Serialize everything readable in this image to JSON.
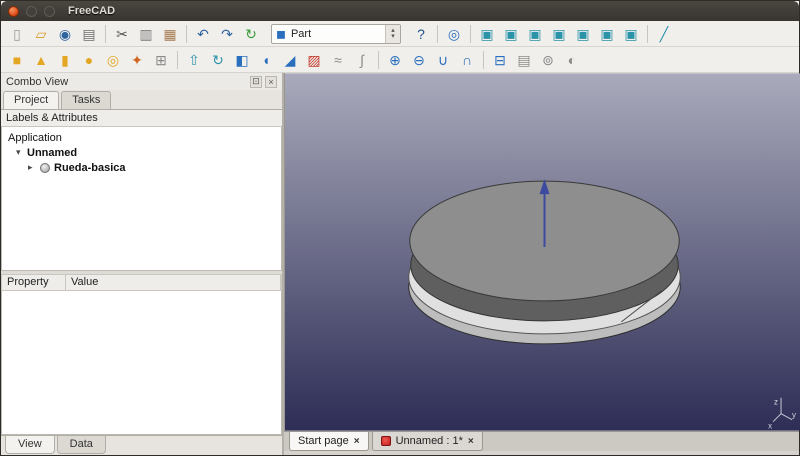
{
  "titlebar": {
    "title": "FreeCAD"
  },
  "glyphs": {
    "spin_up": "▴",
    "spin_down": "▾",
    "dock_float": "⊡",
    "dock_close": "×",
    "expand_open": "▾",
    "expand_closed": "▸"
  },
  "toolbars": {
    "row1a": [
      {
        "name": "new-file",
        "glyph": "▯",
        "color": "#9a9a9a"
      },
      {
        "name": "open-file",
        "glyph": "▱",
        "color": "#d99a2b"
      },
      {
        "name": "save-file",
        "glyph": "◉",
        "color": "#2e64a0"
      },
      {
        "name": "print",
        "glyph": "▤",
        "color": "#6e6e6e"
      },
      {
        "type": "sep"
      },
      {
        "name": "cut",
        "glyph": "✂",
        "color": "#555555"
      },
      {
        "name": "copy",
        "glyph": "▥",
        "color": "#7a7a7a"
      },
      {
        "name": "paste",
        "glyph": "▦",
        "color": "#a67c52"
      },
      {
        "type": "sep"
      },
      {
        "name": "undo",
        "glyph": "↶",
        "color": "#2e64a0"
      },
      {
        "name": "redo",
        "glyph": "↷",
        "color": "#2e64a0"
      },
      {
        "name": "refresh",
        "glyph": "↻",
        "color": "#3a9c3a"
      }
    ],
    "workbench": {
      "selected": "Part",
      "icon_glyph": "◼",
      "icon_color": "#2a6fbd"
    },
    "row1b": [
      {
        "name": "whatsthis",
        "glyph": "?",
        "color": "#1f4f8f"
      },
      {
        "type": "sep"
      },
      {
        "name": "fit-all",
        "glyph": "◎",
        "color": "#2a6fbd"
      },
      {
        "type": "sep"
      },
      {
        "name": "view-axonometric",
        "glyph": "▣",
        "color": "#2a93a8"
      },
      {
        "name": "view-front",
        "glyph": "▣",
        "color": "#2a93a8"
      },
      {
        "name": "view-top",
        "glyph": "▣",
        "color": "#2a93a8"
      },
      {
        "name": "view-right",
        "glyph": "▣",
        "color": "#2a93a8"
      },
      {
        "name": "view-rear",
        "glyph": "▣",
        "color": "#2a93a8"
      },
      {
        "name": "view-bottom",
        "glyph": "▣",
        "color": "#2a93a8"
      },
      {
        "name": "view-left",
        "glyph": "▣",
        "color": "#2a93a8"
      },
      {
        "type": "sep"
      },
      {
        "name": "measure-distance",
        "glyph": "╱",
        "color": "#2a93a8"
      }
    ],
    "row2": [
      {
        "name": "part-box",
        "glyph": "■",
        "color": "#e3a723"
      },
      {
        "name": "part-cone",
        "glyph": "▲",
        "color": "#e3a723"
      },
      {
        "name": "part-cylinder",
        "glyph": "▮",
        "color": "#e3a723"
      },
      {
        "name": "part-sphere",
        "glyph": "●",
        "color": "#e3a723"
      },
      {
        "name": "part-torus",
        "glyph": "◎",
        "color": "#e3a723"
      },
      {
        "name": "part-primitives",
        "glyph": "✦",
        "color": "#d0641f"
      },
      {
        "name": "shape-builder",
        "glyph": "⊞",
        "color": "#8a8a8a"
      },
      {
        "type": "sep"
      },
      {
        "name": "extrude",
        "glyph": "⇧",
        "color": "#2a93a8"
      },
      {
        "name": "revolve",
        "glyph": "↻",
        "color": "#2a93a8"
      },
      {
        "name": "mirror",
        "glyph": "◧",
        "color": "#2a6fbd"
      },
      {
        "name": "fillet",
        "glyph": "◖",
        "color": "#2a6fbd"
      },
      {
        "name": "chamfer",
        "glyph": "◢",
        "color": "#2a6fbd"
      },
      {
        "name": "ruled-surface",
        "glyph": "▨",
        "color": "#c0392b"
      },
      {
        "name": "loft",
        "glyph": "≈",
        "color": "#8a8a8a"
      },
      {
        "name": "sweep",
        "glyph": "∫",
        "color": "#8a8a8a"
      },
      {
        "type": "sep"
      },
      {
        "name": "boolean",
        "glyph": "⊕",
        "color": "#2a6fbd"
      },
      {
        "name": "boolean-cut",
        "glyph": "⊖",
        "color": "#2a6fbd"
      },
      {
        "name": "boolean-union",
        "glyph": "∪",
        "color": "#2a6fbd"
      },
      {
        "name": "boolean-intersection",
        "glyph": "∩",
        "color": "#2a6fbd"
      },
      {
        "type": "sep"
      },
      {
        "name": "section",
        "glyph": "⊟",
        "color": "#2a6fbd"
      },
      {
        "name": "cross-sections",
        "glyph": "▤",
        "color": "#8a8a8a"
      },
      {
        "name": "offset",
        "glyph": "⊚",
        "color": "#8a8a8a"
      },
      {
        "name": "thickness",
        "glyph": "◐",
        "color": "#8a8a8a"
      }
    ]
  },
  "combo_view": {
    "title": "Combo View",
    "tabs": [
      {
        "label": "Project"
      },
      {
        "label": "Tasks"
      }
    ],
    "labels_header": "Labels & Attributes",
    "tree": {
      "root_label": "Application",
      "doc_label": "Unnamed",
      "part_label": "Rueda-basica"
    },
    "property_columns": {
      "property": "Property",
      "value": "Value"
    },
    "bottom_tabs": {
      "view": "View",
      "data": "Data"
    }
  },
  "mdi": {
    "tabs": [
      {
        "label": "Start page"
      },
      {
        "label": "Unnamed : 1*"
      }
    ],
    "close_glyph": "×"
  },
  "viewport": {
    "bg_top": "#a9aabb",
    "bg_bottom": "#2d2d56",
    "disc_top": "#8e8e8e",
    "disc_side_dark": "#5f5f5f",
    "disc_rim": "#e0e0e0",
    "disc_lip": "#bdbdbd",
    "arrow_color": "#3c4aa0",
    "axis_labels": {
      "x": "x",
      "y": "y",
      "z": "z"
    }
  }
}
